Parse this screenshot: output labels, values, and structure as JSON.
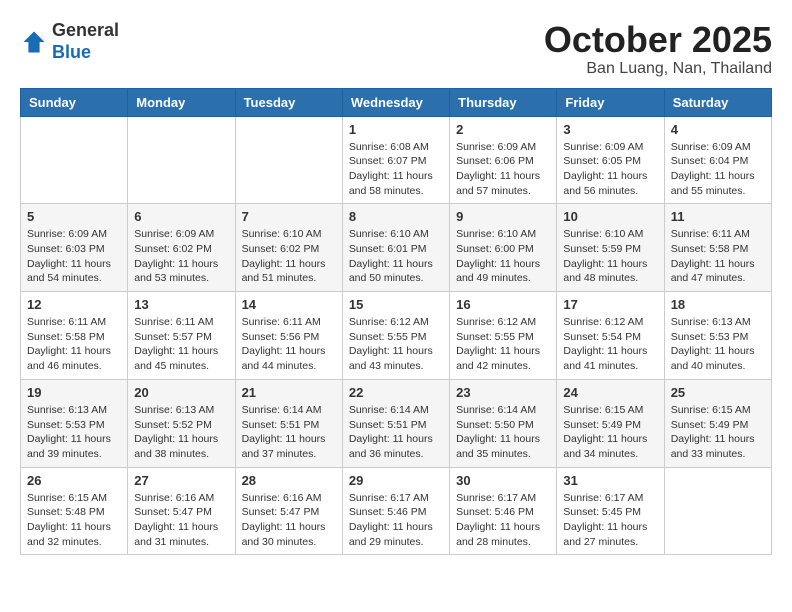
{
  "header": {
    "logo_general": "General",
    "logo_blue": "Blue",
    "month_title": "October 2025",
    "location": "Ban Luang, Nan, Thailand"
  },
  "weekdays": [
    "Sunday",
    "Monday",
    "Tuesday",
    "Wednesday",
    "Thursday",
    "Friday",
    "Saturday"
  ],
  "weeks": [
    [
      {
        "day": "",
        "info": ""
      },
      {
        "day": "",
        "info": ""
      },
      {
        "day": "",
        "info": ""
      },
      {
        "day": "1",
        "info": "Sunrise: 6:08 AM\nSunset: 6:07 PM\nDaylight: 11 hours\nand 58 minutes."
      },
      {
        "day": "2",
        "info": "Sunrise: 6:09 AM\nSunset: 6:06 PM\nDaylight: 11 hours\nand 57 minutes."
      },
      {
        "day": "3",
        "info": "Sunrise: 6:09 AM\nSunset: 6:05 PM\nDaylight: 11 hours\nand 56 minutes."
      },
      {
        "day": "4",
        "info": "Sunrise: 6:09 AM\nSunset: 6:04 PM\nDaylight: 11 hours\nand 55 minutes."
      }
    ],
    [
      {
        "day": "5",
        "info": "Sunrise: 6:09 AM\nSunset: 6:03 PM\nDaylight: 11 hours\nand 54 minutes."
      },
      {
        "day": "6",
        "info": "Sunrise: 6:09 AM\nSunset: 6:02 PM\nDaylight: 11 hours\nand 53 minutes."
      },
      {
        "day": "7",
        "info": "Sunrise: 6:10 AM\nSunset: 6:02 PM\nDaylight: 11 hours\nand 51 minutes."
      },
      {
        "day": "8",
        "info": "Sunrise: 6:10 AM\nSunset: 6:01 PM\nDaylight: 11 hours\nand 50 minutes."
      },
      {
        "day": "9",
        "info": "Sunrise: 6:10 AM\nSunset: 6:00 PM\nDaylight: 11 hours\nand 49 minutes."
      },
      {
        "day": "10",
        "info": "Sunrise: 6:10 AM\nSunset: 5:59 PM\nDaylight: 11 hours\nand 48 minutes."
      },
      {
        "day": "11",
        "info": "Sunrise: 6:11 AM\nSunset: 5:58 PM\nDaylight: 11 hours\nand 47 minutes."
      }
    ],
    [
      {
        "day": "12",
        "info": "Sunrise: 6:11 AM\nSunset: 5:58 PM\nDaylight: 11 hours\nand 46 minutes."
      },
      {
        "day": "13",
        "info": "Sunrise: 6:11 AM\nSunset: 5:57 PM\nDaylight: 11 hours\nand 45 minutes."
      },
      {
        "day": "14",
        "info": "Sunrise: 6:11 AM\nSunset: 5:56 PM\nDaylight: 11 hours\nand 44 minutes."
      },
      {
        "day": "15",
        "info": "Sunrise: 6:12 AM\nSunset: 5:55 PM\nDaylight: 11 hours\nand 43 minutes."
      },
      {
        "day": "16",
        "info": "Sunrise: 6:12 AM\nSunset: 5:55 PM\nDaylight: 11 hours\nand 42 minutes."
      },
      {
        "day": "17",
        "info": "Sunrise: 6:12 AM\nSunset: 5:54 PM\nDaylight: 11 hours\nand 41 minutes."
      },
      {
        "day": "18",
        "info": "Sunrise: 6:13 AM\nSunset: 5:53 PM\nDaylight: 11 hours\nand 40 minutes."
      }
    ],
    [
      {
        "day": "19",
        "info": "Sunrise: 6:13 AM\nSunset: 5:53 PM\nDaylight: 11 hours\nand 39 minutes."
      },
      {
        "day": "20",
        "info": "Sunrise: 6:13 AM\nSunset: 5:52 PM\nDaylight: 11 hours\nand 38 minutes."
      },
      {
        "day": "21",
        "info": "Sunrise: 6:14 AM\nSunset: 5:51 PM\nDaylight: 11 hours\nand 37 minutes."
      },
      {
        "day": "22",
        "info": "Sunrise: 6:14 AM\nSunset: 5:51 PM\nDaylight: 11 hours\nand 36 minutes."
      },
      {
        "day": "23",
        "info": "Sunrise: 6:14 AM\nSunset: 5:50 PM\nDaylight: 11 hours\nand 35 minutes."
      },
      {
        "day": "24",
        "info": "Sunrise: 6:15 AM\nSunset: 5:49 PM\nDaylight: 11 hours\nand 34 minutes."
      },
      {
        "day": "25",
        "info": "Sunrise: 6:15 AM\nSunset: 5:49 PM\nDaylight: 11 hours\nand 33 minutes."
      }
    ],
    [
      {
        "day": "26",
        "info": "Sunrise: 6:15 AM\nSunset: 5:48 PM\nDaylight: 11 hours\nand 32 minutes."
      },
      {
        "day": "27",
        "info": "Sunrise: 6:16 AM\nSunset: 5:47 PM\nDaylight: 11 hours\nand 31 minutes."
      },
      {
        "day": "28",
        "info": "Sunrise: 6:16 AM\nSunset: 5:47 PM\nDaylight: 11 hours\nand 30 minutes."
      },
      {
        "day": "29",
        "info": "Sunrise: 6:17 AM\nSunset: 5:46 PM\nDaylight: 11 hours\nand 29 minutes."
      },
      {
        "day": "30",
        "info": "Sunrise: 6:17 AM\nSunset: 5:46 PM\nDaylight: 11 hours\nand 28 minutes."
      },
      {
        "day": "31",
        "info": "Sunrise: 6:17 AM\nSunset: 5:45 PM\nDaylight: 11 hours\nand 27 minutes."
      },
      {
        "day": "",
        "info": ""
      }
    ]
  ]
}
